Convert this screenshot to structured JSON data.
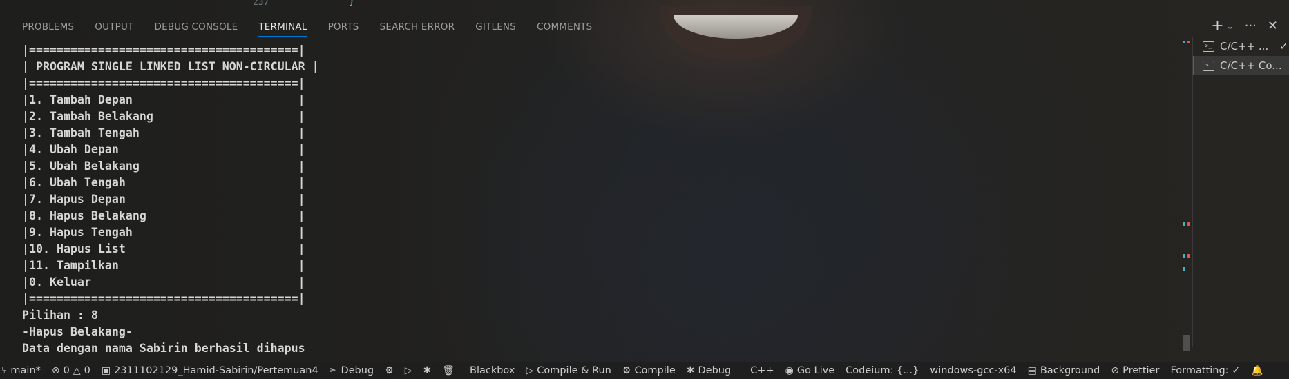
{
  "editor": {
    "line_number": "237",
    "code_fragment": "}"
  },
  "panel": {
    "tabs": [
      "PROBLEMS",
      "OUTPUT",
      "DEBUG CONSOLE",
      "TERMINAL",
      "PORTS",
      "SEARCH ERROR",
      "GITLENS",
      "COMMENTS"
    ],
    "active_tab": "TERMINAL"
  },
  "terminal": {
    "lines": [
      "|=======================================|",
      "| PROGRAM SINGLE LINKED LIST NON-CIRCULAR |",
      "|=======================================|",
      "|1. Tambah Depan                        |",
      "|2. Tambah Belakang                     |",
      "|3. Tambah Tengah                       |",
      "|4. Ubah Depan                          |",
      "|5. Ubah Belakang                       |",
      "|6. Ubah Tengah                         |",
      "|7. Hapus Depan                         |",
      "|8. Hapus Belakang                      |",
      "|9. Hapus Tengah                        |",
      "|10. Hapus List                         |",
      "|11. Tampilkan                          |",
      "|0. Keluar                              |",
      "|=======================================|",
      "Pilihan : 8",
      "-Hapus Belakang-",
      "Data dengan nama Sabirin berhasil dihapus"
    ]
  },
  "terminal_list": {
    "items": [
      {
        "label": "C/C++ ...",
        "icon": "terminal-icon",
        "status": "check-icon"
      },
      {
        "label": "C/C++ Co...",
        "icon": "terminal-icon"
      }
    ]
  },
  "statusbar": {
    "branch": "main*",
    "errors": "0",
    "warnings": "0",
    "folder": "2311102129_Hamid-Sabirin/Pertemuan4",
    "debug": "Debug",
    "blackbox": "Blackbox",
    "compile_run": "Compile & Run",
    "compile": "Compile",
    "debug2": "Debug",
    "language": "C++",
    "go_live": "Go Live",
    "codeium": "Codeium: {...}",
    "config": "windows-gcc-x64",
    "background": "Background",
    "prettier": "Prettier",
    "formatting": "Formatting: ✓"
  },
  "colors": {
    "accent": "#0078d4",
    "marker_red": "#f14c4c",
    "marker_blue": "#4fa3d6",
    "marker_teal": "#3fb6c6"
  }
}
